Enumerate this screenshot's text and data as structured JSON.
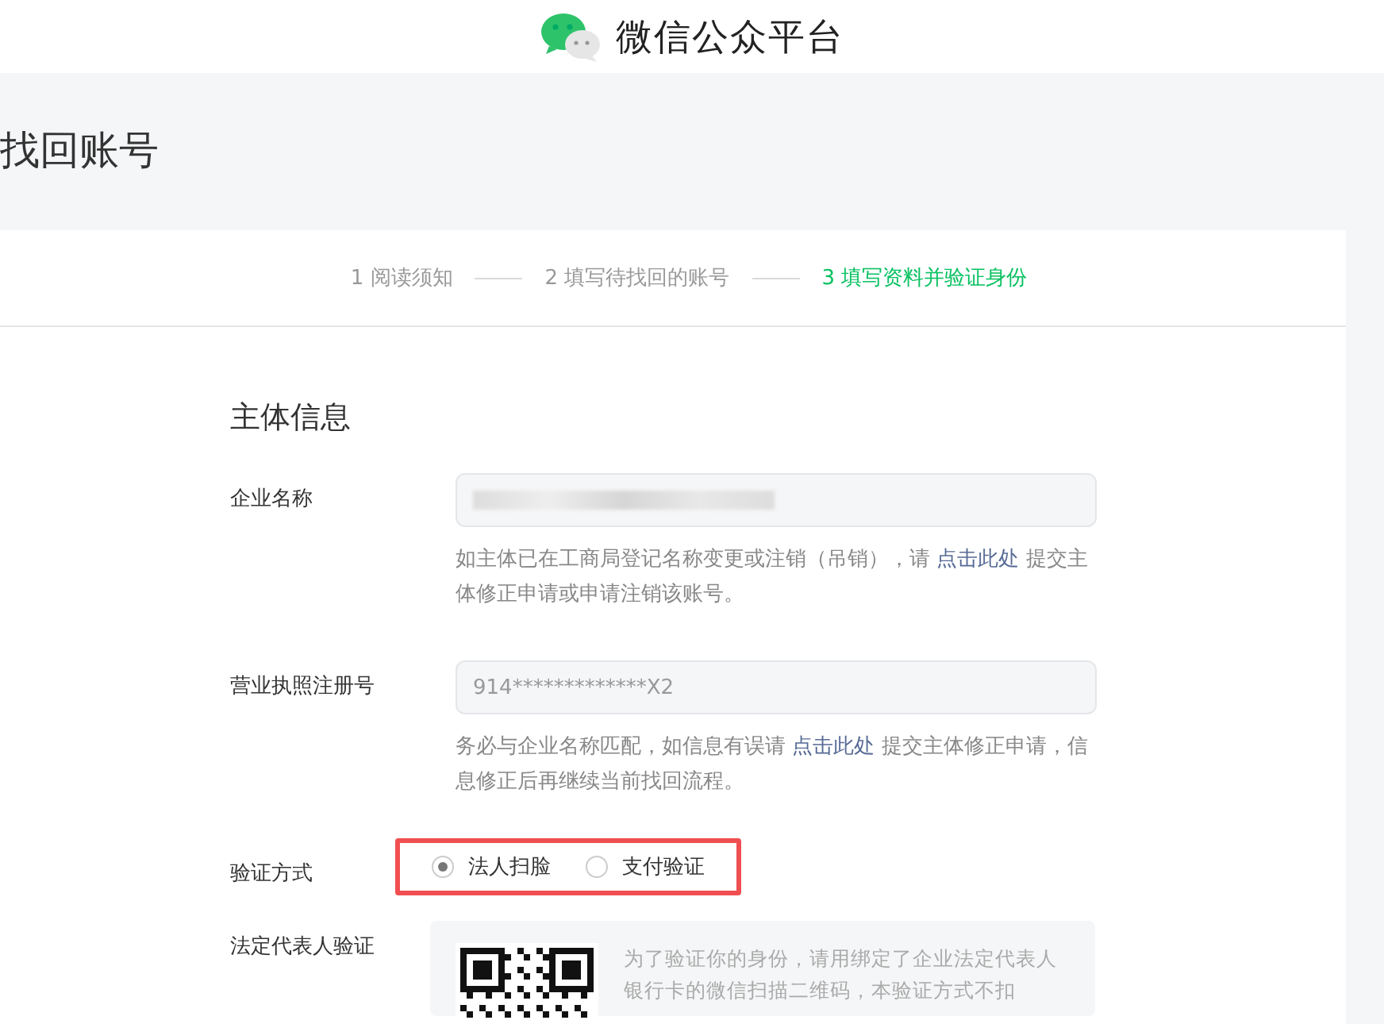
{
  "header": {
    "brand": "微信公众平台"
  },
  "page_title": "找回账号",
  "steps": [
    {
      "label": "1 阅读须知",
      "selected": false
    },
    {
      "label": "2 填写待找回的账号",
      "selected": false
    },
    {
      "label": "3 填写资料并验证身份",
      "selected": true
    }
  ],
  "section_title": "主体信息",
  "fields": [
    {
      "kind": "blurred",
      "label": "企业名称",
      "hint_before": "如主体已在工商局登记名称变更或注销（吊销），请 ",
      "hint_link": "点击此处",
      "hint_after": " 提交主体修正申请或申请注销该账号。"
    },
    {
      "kind": "text",
      "label": "营业执照注册号",
      "value": "914*************X2",
      "hint_before": "务必与企业名称匹配，如信息有误请 ",
      "hint_link": "点击此处",
      "hint_after": " 提交主体修正申请，信息修正后再继续当前找回流程。"
    }
  ],
  "verify_method": {
    "label": "验证方式",
    "options": [
      {
        "label": "法人扫脸",
        "selected": true
      },
      {
        "label": "支付验证",
        "selected": false
      }
    ]
  },
  "legal_rep": {
    "label": "法定代表人验证",
    "text": "为了验证你的身份，请用绑定了企业法定代表人银行卡的微信扫描二维码，本验证方式不扣"
  }
}
